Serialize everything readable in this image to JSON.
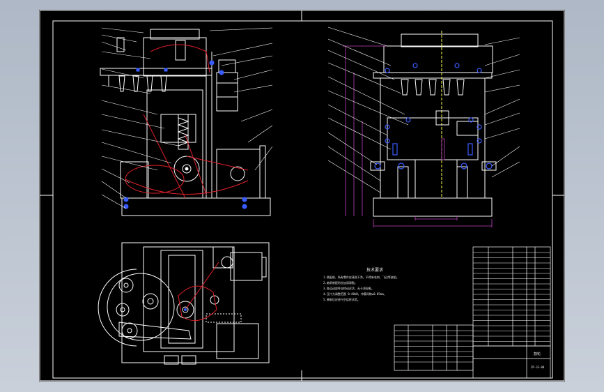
{
  "drawing": {
    "title_block_label": "鼓轮",
    "drawing_number": "ZP-33-00",
    "notes_title": "技术要求",
    "notes": [
      "1.装配前，所有零件应清洗干净，不得有毛刺、飞边等缺陷。",
      "2.轴承装配时应加润滑脂。",
      "3.各运动部件应转动灵活，无卡滞现象。",
      "4.压片力调整范围 0~40kN，冲模间隙≤0.05mm。",
      "5.装配后应进行空运转试验。"
    ],
    "colors": {
      "outline": "#ffffff",
      "belt": "#e0202a",
      "dimension": "#c040c0",
      "fasteners": "#3a5cff",
      "highlight": "#ffff40",
      "background": "#000000"
    }
  }
}
